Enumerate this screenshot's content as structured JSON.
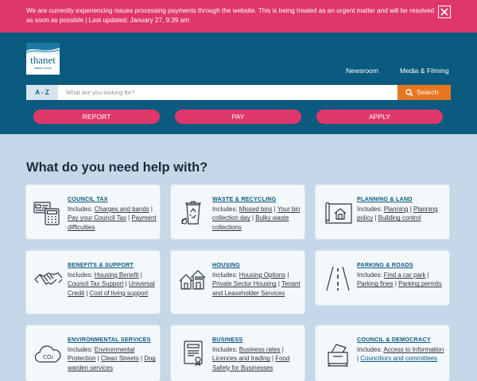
{
  "alert": {
    "message": "We are currently experiencing issues processing payments through the website. This is being treated as an urgent matter and will be resolved as soon as possible | Last updated: January 27, 9:39 am"
  },
  "logo": {
    "name": "thanet",
    "subtitle": "district council"
  },
  "nav": {
    "newsroom": "Newsroom",
    "media": "Media & Filming"
  },
  "search": {
    "az_label": "A - Z",
    "placeholder": "What are you looking for?",
    "button_label": "Search"
  },
  "actions": {
    "report": "REPORT",
    "pay": "PAY",
    "apply": "APPLY"
  },
  "help_heading": "What do you need help with?",
  "colors": {
    "alert": "#e0376a",
    "header": "#0b5a80",
    "search_button": "#e87722",
    "background": "#c5d7e8"
  },
  "cards": [
    {
      "title": "COUNCIL TAX",
      "icon": "calculator-card-icon",
      "prefix": "Includes: ",
      "links": [
        "Charges and bands",
        "Pay your Council Tax",
        "Payment difficulties"
      ]
    },
    {
      "title": "WASTE & RECYCLING",
      "icon": "recycling-bin-icon",
      "prefix": "Includes: ",
      "links": [
        "Missed bins",
        "Your bin collection day",
        "Bulky waste collections"
      ]
    },
    {
      "title": "PLANNING & LAND",
      "icon": "house-plan-icon",
      "prefix": "Includes: ",
      "links": [
        "Planning",
        "Planning policy",
        "Building control"
      ]
    },
    {
      "title": "BENEFITS & SUPPORT",
      "icon": "handshake-icon",
      "prefix": "Includes: ",
      "links": [
        "Housing Benefit",
        "Council Tax Support",
        "Universal Credit",
        "Cost of living support"
      ]
    },
    {
      "title": "HOUSING",
      "icon": "houses-icon",
      "prefix": "Includes: ",
      "links": [
        "Housing Options",
        "Private Sector Housing",
        "Tenant and Leaseholder Services"
      ]
    },
    {
      "title": "PARKING & ROADS",
      "icon": "road-icon",
      "prefix": "Includes: ",
      "links": [
        "Find a car park",
        "Parking fines",
        "Parking permits"
      ]
    },
    {
      "title": "ENVIRONMENTAL SERVICES",
      "icon": "co2-cloud-icon",
      "prefix": "Includes: ",
      "links": [
        "Environmental Protection",
        "Clean Streets",
        "Dog warden services"
      ]
    },
    {
      "title": "BUSINESS",
      "icon": "certificate-icon",
      "prefix": "Includes: ",
      "links": [
        "Business rates",
        "Licences and trading",
        "Food Safety for Businesses"
      ]
    },
    {
      "title": "COUNCIL & DEMOCRACY",
      "icon": "ballot-box-icon",
      "prefix": "Includes: ",
      "links": [
        "Access to Information",
        "Councillors and committees"
      ]
    }
  ]
}
